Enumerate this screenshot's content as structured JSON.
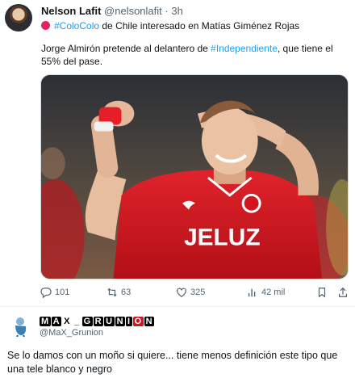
{
  "tweet": {
    "author_name": "Nelson Lafit",
    "handle": "@nelsonlafit",
    "separator": "·",
    "time": "3h",
    "line1_hashtag": "#ColoColo",
    "line1_rest": " de Chile interesado en Matías Giménez Rojas",
    "body_before": "Jorge Almirón pretende al delantero de ",
    "body_hashtag": "#Independiente",
    "body_after": ", que tiene el 55% del pase.",
    "jersey_text": "JELUZ",
    "actions": {
      "replies": "101",
      "retweets": "63",
      "likes": "325",
      "views": "42 mil"
    }
  },
  "reply": {
    "display_name_letters": [
      "M",
      "A",
      "X",
      "_",
      "G",
      "R",
      "U",
      "N",
      "I",
      "O",
      "N"
    ],
    "handle": "@MaX_Grunion",
    "text": "Se lo damos con un moño si quiere... tiene  menos definición este tipo que una tele blanco y negro"
  },
  "colors": {
    "link": "#1d9bf0",
    "secondary_text": "#536471",
    "jersey_red": "#d4141c"
  },
  "icons": [
    "reply-icon",
    "retweet-icon",
    "like-icon",
    "views-icon",
    "bookmark-icon",
    "share-icon"
  ]
}
